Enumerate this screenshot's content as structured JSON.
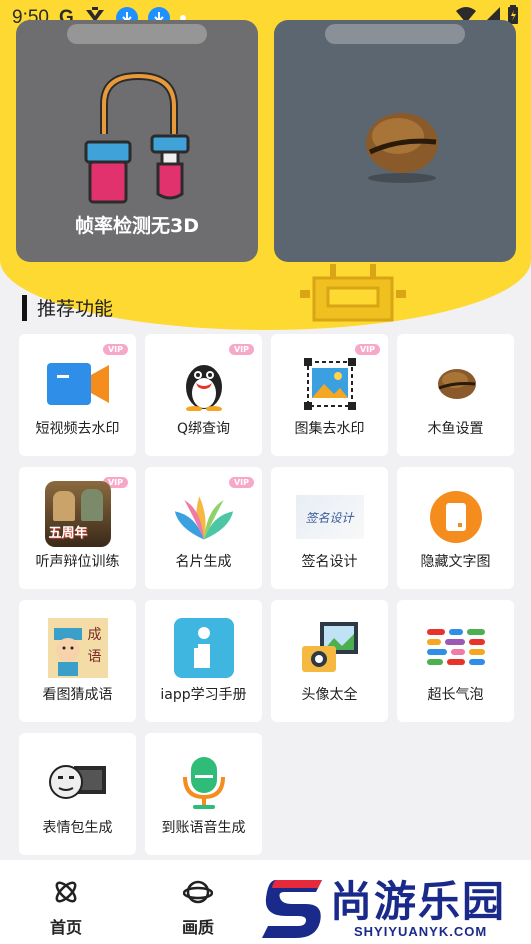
{
  "status_bar": {
    "time": "9:50",
    "google_letter": "G"
  },
  "featured": [
    {
      "title": "帧率检测无3D",
      "icon": "paint-roller-icon"
    },
    {
      "title": "",
      "icon": "wooden-fish-icon"
    }
  ],
  "section": {
    "title": "推荐功能"
  },
  "tiles": [
    {
      "label": "短视频去水印",
      "icon": "video-camera-icon",
      "vip": "VIP"
    },
    {
      "label": "Q绑查询",
      "icon": "penguin-icon",
      "vip": "VIP"
    },
    {
      "label": "图集去水印",
      "icon": "image-crop-icon",
      "vip": "VIP"
    },
    {
      "label": "木鱼设置",
      "icon": "wooden-fish-icon",
      "vip": ""
    },
    {
      "label": "听声辩位训练",
      "icon": "game-poster-icon",
      "vip": "VIP",
      "poster_text": "五周年"
    },
    {
      "label": "名片生成",
      "icon": "petals-icon",
      "vip": "VIP"
    },
    {
      "label": "签名设计",
      "icon": "signature-icon",
      "vip": "",
      "signature_text": "签名设计"
    },
    {
      "label": "隐藏文字图",
      "icon": "hidden-text-icon",
      "vip": ""
    },
    {
      "label": "看图猜成语",
      "icon": "idiom-guess-icon",
      "vip": "",
      "idiom_text": "成语"
    },
    {
      "label": "iapp学习手册",
      "icon": "info-manual-icon",
      "vip": ""
    },
    {
      "label": "头像太全",
      "icon": "avatar-camera-icon",
      "vip": ""
    },
    {
      "label": "超长气泡",
      "icon": "bubble-list-icon",
      "vip": ""
    },
    {
      "label": "表情包生成",
      "icon": "meme-face-icon",
      "vip": ""
    },
    {
      "label": "到账语音生成",
      "icon": "microphone-icon",
      "vip": ""
    }
  ],
  "bottom_nav": [
    {
      "label": "首页",
      "icon": "atom-icon"
    },
    {
      "label": "画质",
      "icon": "planet-icon"
    }
  ],
  "brand": {
    "name": "尚游乐园",
    "url": "SHYIYUANYK.COM",
    "color": "#1a2a8a",
    "accent": "#e62a3c"
  },
  "colors": {
    "hero": "#fdd932",
    "page": "#f1f1f4",
    "vip": "#f7a8c8"
  }
}
